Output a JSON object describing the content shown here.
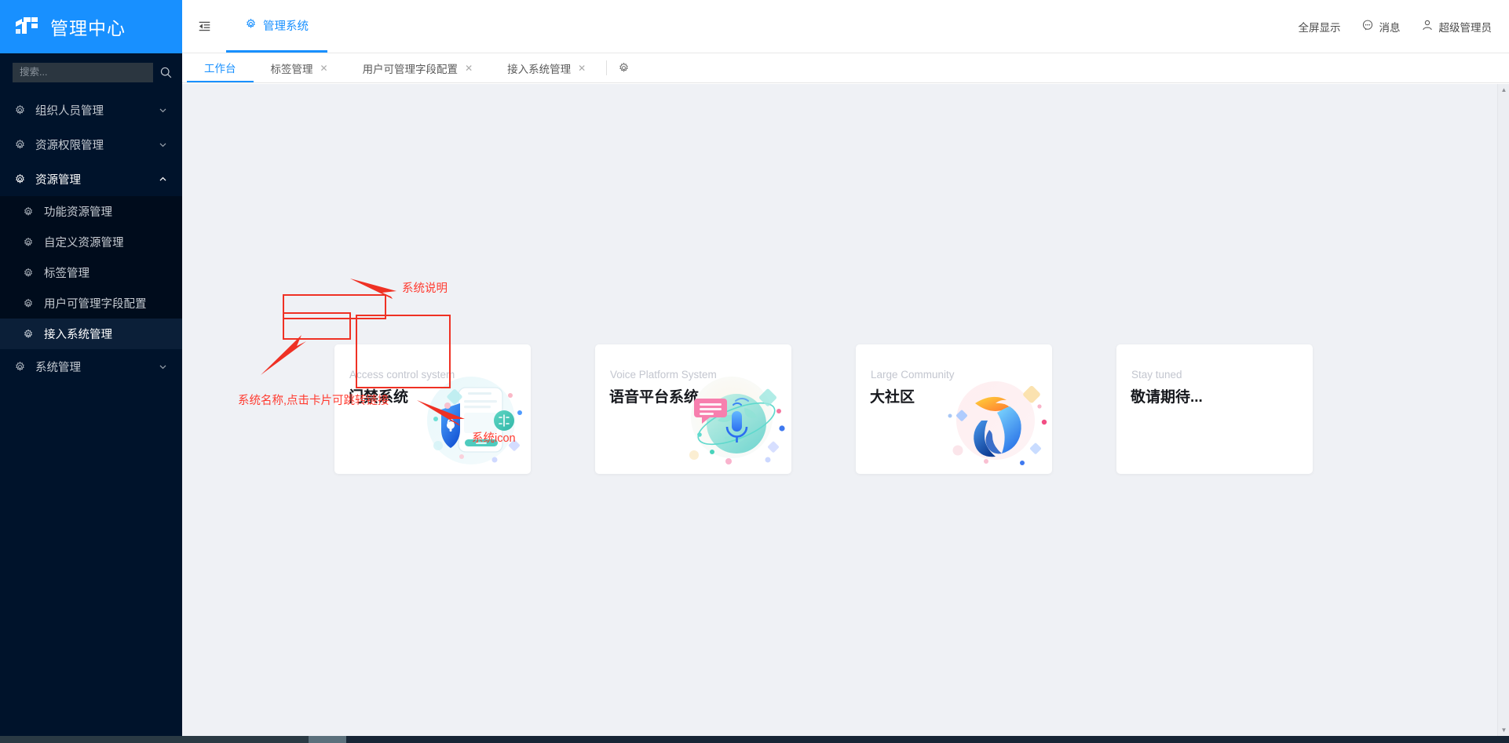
{
  "sidebar": {
    "brand_title": "管理中心",
    "brand_logo_icon": "logo-icon",
    "search_placeholder": "搜索...",
    "search_value": "",
    "search_icon": "search-icon",
    "menu": [
      {
        "label": "组织人员管理",
        "icon": "gear-icon",
        "arrow": "chevron-down-icon",
        "expanded": false
      },
      {
        "label": "资源权限管理",
        "icon": "gear-icon",
        "arrow": "chevron-down-icon",
        "expanded": false
      },
      {
        "label": "资源管理",
        "icon": "gear-icon",
        "arrow": "chevron-up-icon",
        "expanded": true,
        "children": [
          {
            "label": "功能资源管理",
            "icon": "gear-icon",
            "active": false
          },
          {
            "label": "自定义资源管理",
            "icon": "gear-icon",
            "active": false
          },
          {
            "label": "标签管理",
            "icon": "gear-icon",
            "active": false
          },
          {
            "label": "用户可管理字段配置",
            "icon": "gear-icon",
            "active": false
          },
          {
            "label": "接入系统管理",
            "icon": "gear-icon",
            "active": true
          }
        ]
      },
      {
        "label": "系统管理",
        "icon": "gear-icon",
        "arrow": "chevron-down-icon",
        "expanded": false
      }
    ]
  },
  "header": {
    "collapse_icon": "menu-fold-icon",
    "tab_label": "管理系统",
    "tab_icon": "gear-icon",
    "fullscreen_label": "全屏显示",
    "message_label": "消息",
    "message_icon": "message-icon",
    "user_label": "超级管理员",
    "user_icon": "user-icon"
  },
  "tabstrip": {
    "tabs": [
      {
        "label": "工作台",
        "closable": false,
        "active": true
      },
      {
        "label": "标签管理",
        "closable": true,
        "active": false
      },
      {
        "label": "用户可管理字段配置",
        "closable": true,
        "active": false
      },
      {
        "label": "接入系统管理",
        "closable": true,
        "active": false
      }
    ],
    "close_glyph": "✕",
    "settings_icon": "gear-icon"
  },
  "main": {
    "cards": [
      {
        "en": "Access control system",
        "cn": "门禁系统",
        "art": "shield-lock-illustration"
      },
      {
        "en": "Voice Platform System",
        "cn": "语音平台系统",
        "art": "globe-microphone-illustration"
      },
      {
        "en": "Large Community",
        "cn": "大社区",
        "art": "hands-community-illustration"
      },
      {
        "en": "Stay tuned",
        "cn": "敬请期待...",
        "art": "none"
      }
    ]
  },
  "annotations": {
    "color": "#ff3b30",
    "items": [
      {
        "text": "系统说明",
        "target": "card-english-description"
      },
      {
        "text": "系统名称,点击卡片可跳转链接",
        "target": "card-chinese-name"
      },
      {
        "text": "系统icon",
        "target": "card-illustration"
      }
    ]
  },
  "scrollbar": {
    "up_glyph": "▲",
    "down_glyph": "▼"
  }
}
